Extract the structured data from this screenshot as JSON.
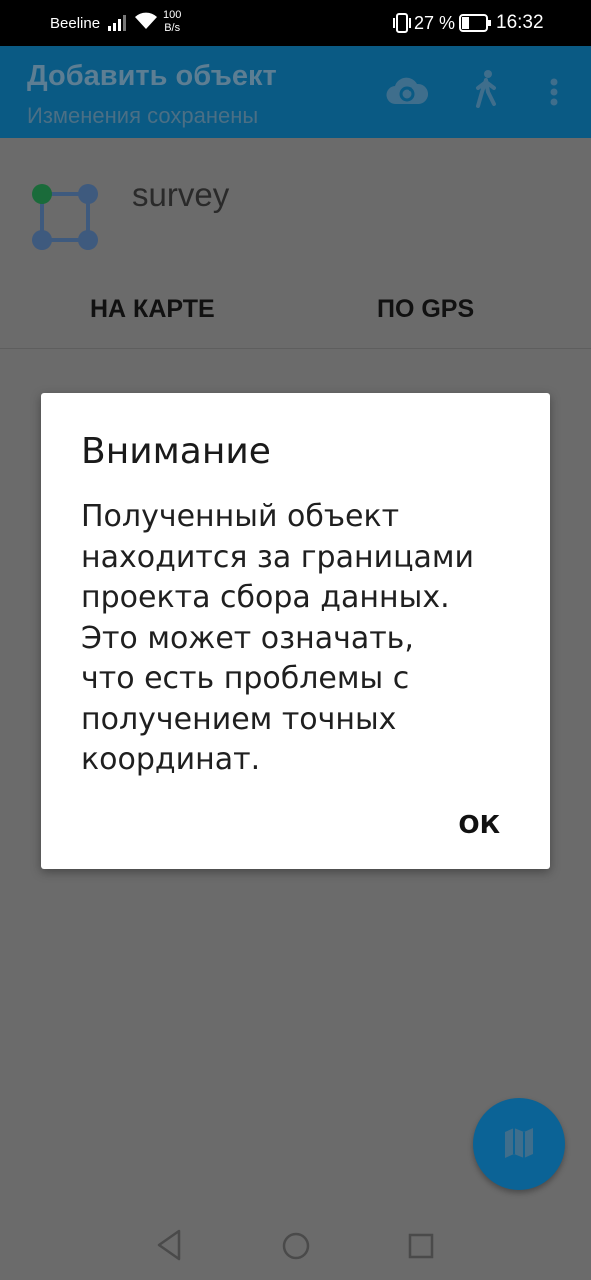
{
  "status_bar": {
    "carrier": "Beeline",
    "net_speed_value": "100",
    "net_speed_unit": "B/s",
    "battery_percent": "27 %",
    "time": "16:32"
  },
  "app_bar": {
    "title": "Добавить объект",
    "subtitle": "Изменения сохранены",
    "icons": [
      "cloud-sync-icon",
      "walking-person-icon",
      "more-vert-icon"
    ]
  },
  "layer": {
    "name": "survey",
    "icon": "polygon-icon"
  },
  "tabs": [
    {
      "label": "НА КАРТЕ"
    },
    {
      "label": "ПО GPS"
    }
  ],
  "dialog": {
    "title": "Внимание",
    "message": "Полученный объект\nнаходится за границами\nпроекта сбора данных.\nЭто может означать,\nчто есть проблемы с\nполучением точных\nкоординат.",
    "ok_label": "ОК"
  },
  "fab": {
    "icon": "map-icon"
  },
  "colors": {
    "app_bar": "#0a5a84",
    "dim_background": "#6b6b6b",
    "fab": "#0b6396",
    "polygon_vertex": "#3e5a7e",
    "polygon_start_vertex": "#1a6b3a"
  }
}
